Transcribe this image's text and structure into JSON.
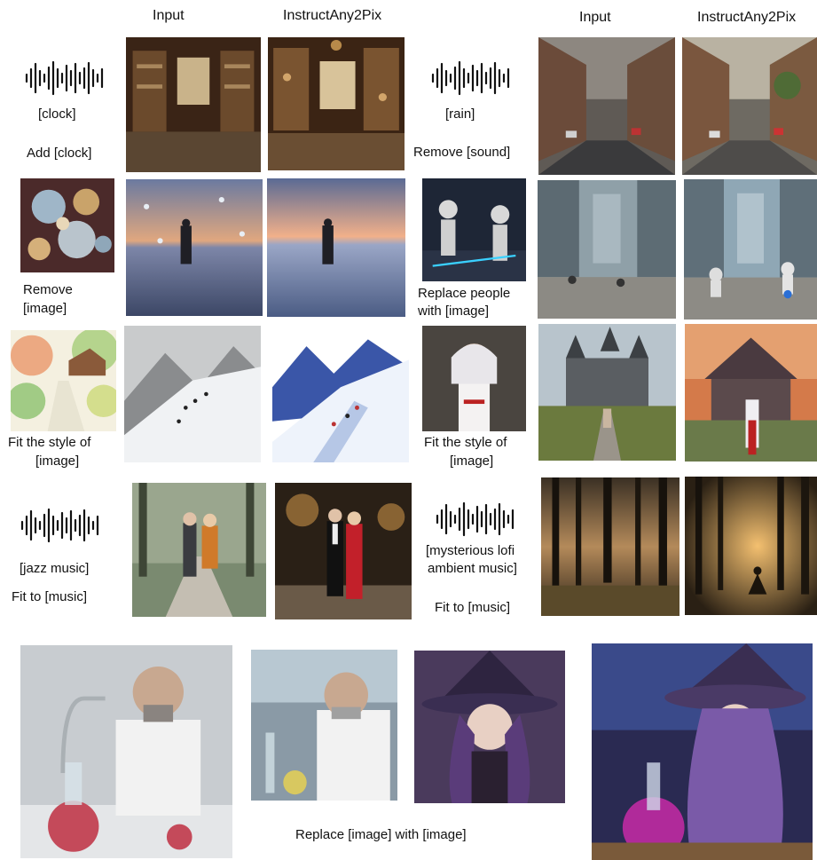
{
  "headers": {
    "left_input": "Input",
    "left_output": "InstructAny2Pix",
    "right_input": "Input",
    "right_output": "InstructAny2Pix"
  },
  "row1_left": {
    "modality": "[clock]",
    "instruction": "Add [clock]"
  },
  "row1_right": {
    "modality": "[rain]",
    "instruction": "Remove  [sound]"
  },
  "row2_left": {
    "instruction_line1": "Remove",
    "instruction_line2": "[image]"
  },
  "row2_right": {
    "instruction_line1": "Replace people",
    "instruction_line2": "with [image]"
  },
  "row3_left": {
    "instruction_line1": "Fit the style of",
    "instruction_line2": "[image]"
  },
  "row3_right": {
    "instruction_line1": "Fit the style of",
    "instruction_line2": "[image]"
  },
  "row4_left": {
    "modality": "[jazz music]",
    "instruction": "Fit to  [music]"
  },
  "row4_right": {
    "modality_line1": "[mysterious lofi",
    "modality_line2": "ambient music]",
    "instruction": "Fit to [music]"
  },
  "bottom": {
    "instruction": "Replace [image] with [image]"
  },
  "images": {
    "r1_in_left": "antique-clock-shop-interior",
    "r1_out_left": "antique-shop-with-clock",
    "r1_in_right": "rainy-city-street",
    "r1_out_right": "city-street-rain-removed",
    "r2_cond_left": "bubbles",
    "r2_in_left": "person-on-frozen-lake-with-bubbles",
    "r2_out_left": "person-on-frozen-lake",
    "r2_cond_right": "robots",
    "r2_in_right": "futuristic-city-plaza",
    "r2_out_right": "futuristic-city-with-robots",
    "r3_cond_left": "watercolor-landscape",
    "r3_in_left": "snowy-mountain-hikers",
    "r3_out_left": "watercolor-snowy-mountain",
    "r3_cond_right": "anime-girl",
    "r3_in_right": "woman-before-castle",
    "r3_out_right": "anime-girl-before-castle",
    "r4_in_left": "couple-on-forest-path",
    "r4_out_left": "couple-in-jazz-club",
    "r4_in_right": "dark-forest",
    "r4_out_right": "forest-meditation-sunlight",
    "b_in": "scientist-in-lab",
    "b_src": "scientist-portrait",
    "b_ref": "purple-witch",
    "b_out": "witch-in-lab"
  }
}
